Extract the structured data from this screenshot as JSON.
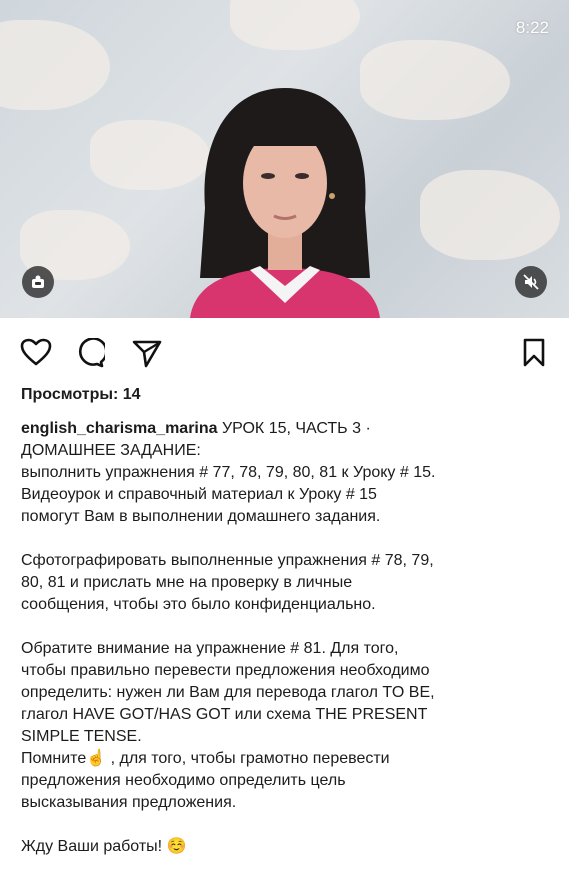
{
  "status_bar": {
    "time": "8:22"
  },
  "post": {
    "views_label": "Просмотры: 14",
    "username": "english_charisma_marina",
    "caption_first": " УРОК 15, ЧАСТЬ 3 ·",
    "lines": [
      "ДОМАШНЕЕ ЗАДАНИЕ:",
      "выполнить упражнения # 77, 78, 79, 80, 81 к Уроку # 15.",
      "Видеоурок и справочный материал к Уроку # 15",
      "помогут Вам в выполнении домашнего задания.",
      "",
      "Сфотографировать выполненные упражнения # 78, 79,",
      "80, 81  и прислать мне на проверку в личные",
      "сообщения, чтобы это было конфиденциально.",
      "",
      "Обратите внимание на упражнение # 81. Для того,",
      "чтобы правильно перевести предложения необходимо",
      "определить: нужен ли Вам для перевода глагол TO BE,",
      "глагол HAVE GOT/HAS GOT или схема THE PRESENT",
      "SIMPLE TENSE.",
      "Помните☝️ , для того, чтобы грамотно перевести",
      "предложения необходимо определить цель",
      "высказывания предложения.",
      "",
      "Жду Ваши работы! ☺️"
    ]
  },
  "colors": {
    "sweater": "#d8356f",
    "hair": "#1f1a1a",
    "skin": "#e7b9a6"
  }
}
